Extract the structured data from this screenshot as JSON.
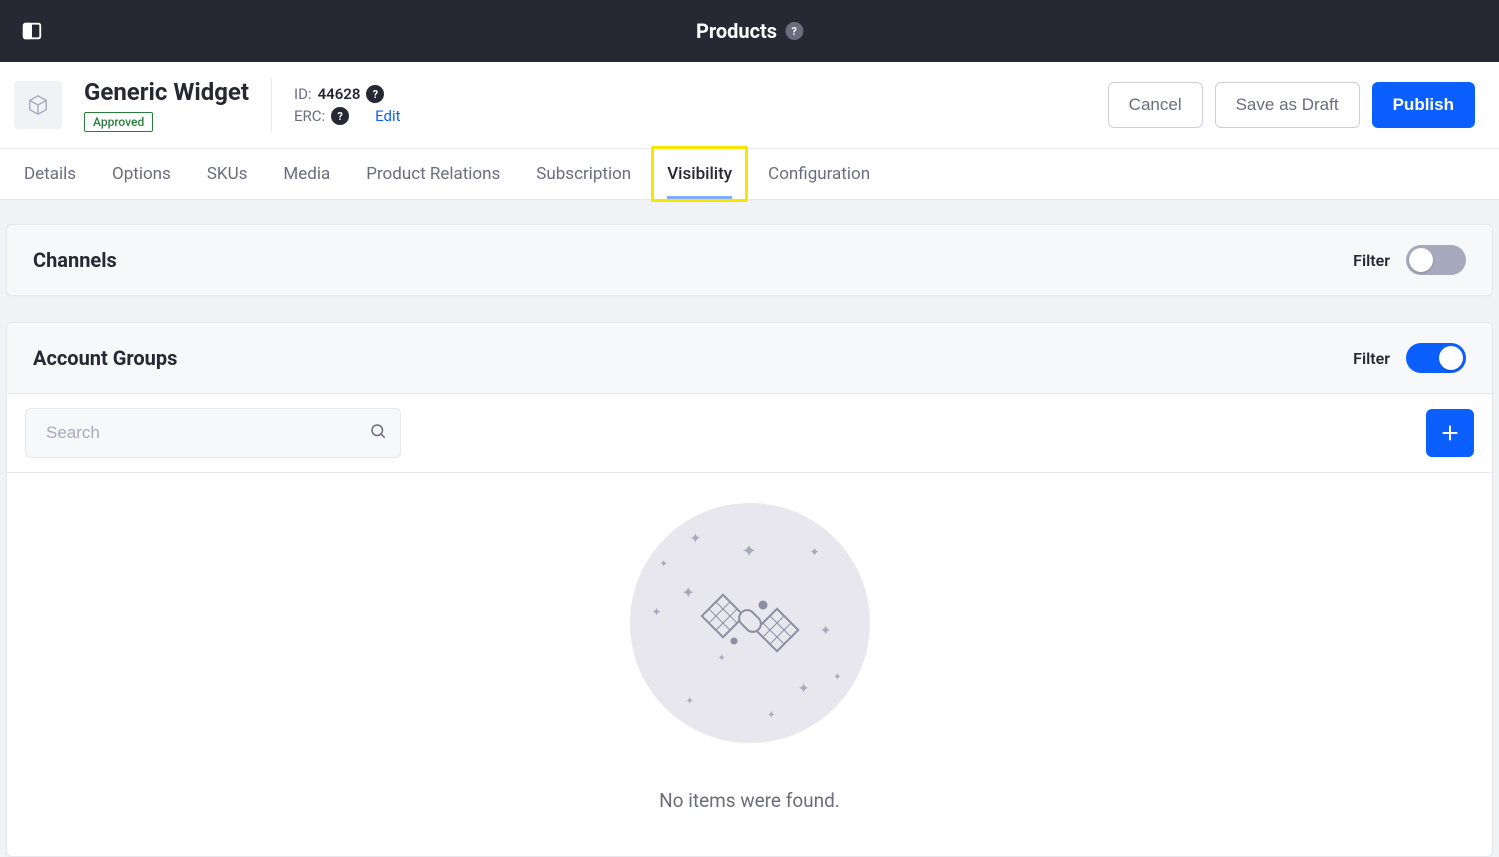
{
  "topbar": {
    "title": "Products"
  },
  "product": {
    "name": "Generic Widget",
    "status": "Approved",
    "id_label": "ID:",
    "id_value": "44628",
    "erc_label": "ERC:",
    "edit_label": "Edit"
  },
  "actions": {
    "cancel": "Cancel",
    "save_draft": "Save as Draft",
    "publish": "Publish"
  },
  "tabs": [
    {
      "label": "Details",
      "active": false
    },
    {
      "label": "Options",
      "active": false
    },
    {
      "label": "SKUs",
      "active": false
    },
    {
      "label": "Media",
      "active": false
    },
    {
      "label": "Product Relations",
      "active": false
    },
    {
      "label": "Subscription",
      "active": false
    },
    {
      "label": "Visibility",
      "active": true
    },
    {
      "label": "Configuration",
      "active": false
    }
  ],
  "channels": {
    "title": "Channels",
    "filter_label": "Filter",
    "filter_on": false
  },
  "account_groups": {
    "title": "Account Groups",
    "filter_label": "Filter",
    "filter_on": true,
    "search_placeholder": "Search",
    "empty_message": "No items were found."
  }
}
